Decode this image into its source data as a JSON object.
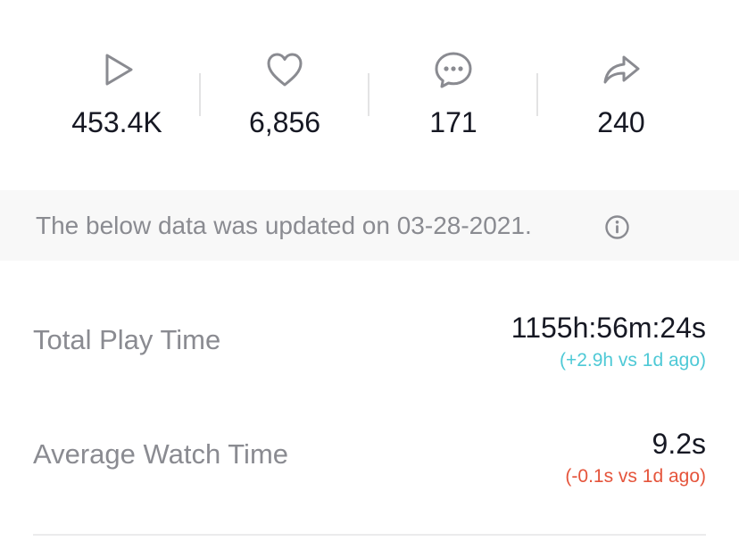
{
  "stats": {
    "views": {
      "icon": "play-icon",
      "value": "453.4K"
    },
    "likes": {
      "icon": "heart-icon",
      "value": "6,856"
    },
    "comments": {
      "icon": "comment-bubble-icon",
      "value": "171"
    },
    "shares": {
      "icon": "share-arrow-icon",
      "value": "240"
    }
  },
  "banner": {
    "text": "The below data was updated on 03-28-2021.",
    "icon": "info-icon"
  },
  "metrics": {
    "total_play_time": {
      "label": "Total Play Time",
      "value": "1155h:56m:24s",
      "delta": "(+2.9h vs 1d ago)",
      "delta_color": "#4ec9d6"
    },
    "average_watch_time": {
      "label": "Average Watch Time",
      "value": "9.2s",
      "delta": "(-0.1s vs 1d ago)",
      "delta_color": "#e5543b"
    }
  },
  "colors": {
    "icon_gray": "#8a8b91",
    "text_primary": "#161823",
    "text_secondary": "#8a8b91",
    "banner_bg": "#f8f8f8"
  }
}
